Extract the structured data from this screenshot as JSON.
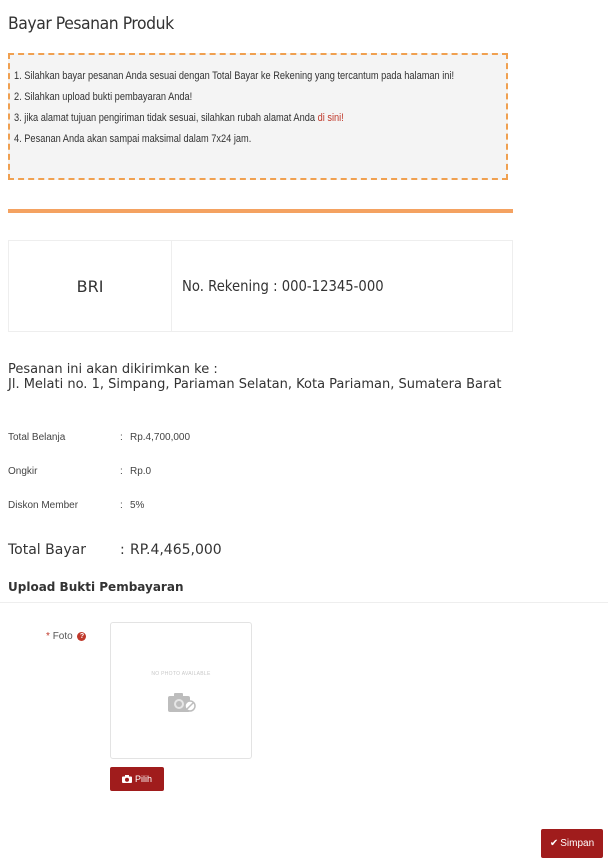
{
  "page": {
    "title": "Bayar Pesanan Produk"
  },
  "instructions": {
    "line1": "1. Silahkan bayar pesanan Anda sesuai dengan Total Bayar ke Rekening yang tercantum pada halaman ini!",
    "line2": "2. Silahkan upload bukti pembayaran Anda!",
    "line3_prefix": "3. jika alamat tujuan pengiriman tidak sesuai, silahkan rubah alamat Anda ",
    "line3_link": "di sini!",
    "line4": "4. Pesanan Anda akan sampai maksimal dalam 7x24 jam."
  },
  "bank": {
    "name": "BRI",
    "account": "No. Rekening : 000-12345-000"
  },
  "shipping": {
    "label": "Pesanan ini akan dikirimkan ke :",
    "address": "Jl. Melati no. 1, Simpang, Pariaman Selatan, Kota Pariaman, Sumatera Barat"
  },
  "summary": {
    "separator": ":",
    "rows": [
      {
        "label": "Total Belanja",
        "value": "Rp.4,700,000"
      },
      {
        "label": "Ongkir",
        "value": "Rp.0"
      },
      {
        "label": "Diskon Member",
        "value": "5%"
      }
    ],
    "total_label": "Total Bayar",
    "total_value": "RP.4,465,000"
  },
  "upload": {
    "title": "Upload Bukti Pembayaran",
    "required_mark": "*",
    "foto_label": "Foto",
    "help_glyph": "?",
    "no_photo_text": "NO PHOTO AVAILABLE",
    "pilih_label": "Pilih",
    "simpan_label": "Simpan",
    "simpan_check": "✔"
  },
  "colors": {
    "accent": "#a01c1c",
    "orange": "#f4a261",
    "link": "#c0392b"
  },
  "icons": {
    "camera": "camera-icon",
    "help": "question-circle-icon",
    "check": "check-icon"
  }
}
